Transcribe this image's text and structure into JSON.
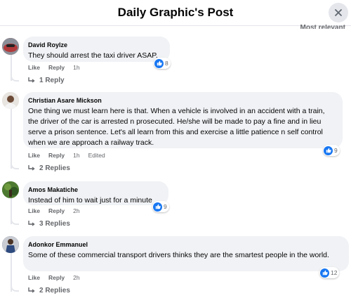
{
  "header": {
    "title": "Daily Graphic's Post",
    "sort_label": "Most relevant"
  },
  "comments": [
    {
      "author": "David Roylze",
      "text": "They should arrest the taxi driver ASAP.",
      "like_label": "Like",
      "reply_label": "Reply",
      "time": "1h",
      "edited": "",
      "reactions": "8",
      "replies": "1 Reply",
      "avatar_color": "#b23a3a"
    },
    {
      "author": "Christian Asare Mickson",
      "text": "One thing we must learn here is that. When a vehicle is involved in an accident with a train, the driver of the car is arrested n prosecuted. He/she will be made to pay a fine and in lieu serve a prison sentence. Let's all learn from this and exercise a little patience n self control when we are approach a railway track.",
      "like_label": "Like",
      "reply_label": "Reply",
      "time": "1h",
      "edited": "Edited",
      "reactions": "9",
      "replies": "2 Replies",
      "avatar_color": "#d8d4cf"
    },
    {
      "author": "Amos Makatiche",
      "text": "Instead of him to wait just for a minute",
      "like_label": "Like",
      "reply_label": "Reply",
      "time": "2h",
      "edited": "",
      "reactions": "9",
      "replies": "3 Replies",
      "avatar_color": "#3f6b2a"
    },
    {
      "author": "Adonkor Emmanuel",
      "text": "Some of these commercial transport drivers thinks they are the smartest people in the world.",
      "like_label": "Like",
      "reply_label": "Reply",
      "time": "2h",
      "edited": "",
      "reactions": "12",
      "replies": "2 Replies",
      "avatar_color": "#3a4f7a"
    }
  ],
  "colors": {
    "accent": "#1877f2",
    "bubble": "#f0f2f5",
    "muted": "#65676b"
  }
}
